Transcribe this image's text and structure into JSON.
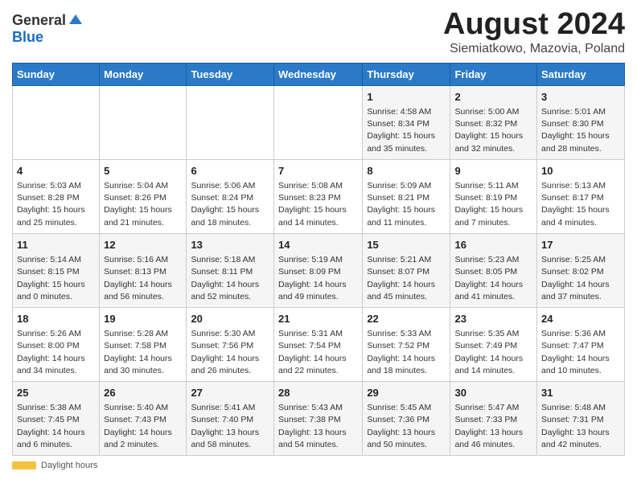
{
  "header": {
    "logo_general": "General",
    "logo_blue": "Blue",
    "month_title": "August 2024",
    "location": "Siemiatkowo, Mazovia, Poland"
  },
  "days_of_week": [
    "Sunday",
    "Monday",
    "Tuesday",
    "Wednesday",
    "Thursday",
    "Friday",
    "Saturday"
  ],
  "weeks": [
    [
      {
        "day": "",
        "info": ""
      },
      {
        "day": "",
        "info": ""
      },
      {
        "day": "",
        "info": ""
      },
      {
        "day": "",
        "info": ""
      },
      {
        "day": "1",
        "info": "Sunrise: 4:58 AM\nSunset: 8:34 PM\nDaylight: 15 hours\nand 35 minutes."
      },
      {
        "day": "2",
        "info": "Sunrise: 5:00 AM\nSunset: 8:32 PM\nDaylight: 15 hours\nand 32 minutes."
      },
      {
        "day": "3",
        "info": "Sunrise: 5:01 AM\nSunset: 8:30 PM\nDaylight: 15 hours\nand 28 minutes."
      }
    ],
    [
      {
        "day": "4",
        "info": "Sunrise: 5:03 AM\nSunset: 8:28 PM\nDaylight: 15 hours\nand 25 minutes."
      },
      {
        "day": "5",
        "info": "Sunrise: 5:04 AM\nSunset: 8:26 PM\nDaylight: 15 hours\nand 21 minutes."
      },
      {
        "day": "6",
        "info": "Sunrise: 5:06 AM\nSunset: 8:24 PM\nDaylight: 15 hours\nand 18 minutes."
      },
      {
        "day": "7",
        "info": "Sunrise: 5:08 AM\nSunset: 8:23 PM\nDaylight: 15 hours\nand 14 minutes."
      },
      {
        "day": "8",
        "info": "Sunrise: 5:09 AM\nSunset: 8:21 PM\nDaylight: 15 hours\nand 11 minutes."
      },
      {
        "day": "9",
        "info": "Sunrise: 5:11 AM\nSunset: 8:19 PM\nDaylight: 15 hours\nand 7 minutes."
      },
      {
        "day": "10",
        "info": "Sunrise: 5:13 AM\nSunset: 8:17 PM\nDaylight: 15 hours\nand 4 minutes."
      }
    ],
    [
      {
        "day": "11",
        "info": "Sunrise: 5:14 AM\nSunset: 8:15 PM\nDaylight: 15 hours\nand 0 minutes."
      },
      {
        "day": "12",
        "info": "Sunrise: 5:16 AM\nSunset: 8:13 PM\nDaylight: 14 hours\nand 56 minutes."
      },
      {
        "day": "13",
        "info": "Sunrise: 5:18 AM\nSunset: 8:11 PM\nDaylight: 14 hours\nand 52 minutes."
      },
      {
        "day": "14",
        "info": "Sunrise: 5:19 AM\nSunset: 8:09 PM\nDaylight: 14 hours\nand 49 minutes."
      },
      {
        "day": "15",
        "info": "Sunrise: 5:21 AM\nSunset: 8:07 PM\nDaylight: 14 hours\nand 45 minutes."
      },
      {
        "day": "16",
        "info": "Sunrise: 5:23 AM\nSunset: 8:05 PM\nDaylight: 14 hours\nand 41 minutes."
      },
      {
        "day": "17",
        "info": "Sunrise: 5:25 AM\nSunset: 8:02 PM\nDaylight: 14 hours\nand 37 minutes."
      }
    ],
    [
      {
        "day": "18",
        "info": "Sunrise: 5:26 AM\nSunset: 8:00 PM\nDaylight: 14 hours\nand 34 minutes."
      },
      {
        "day": "19",
        "info": "Sunrise: 5:28 AM\nSunset: 7:58 PM\nDaylight: 14 hours\nand 30 minutes."
      },
      {
        "day": "20",
        "info": "Sunrise: 5:30 AM\nSunset: 7:56 PM\nDaylight: 14 hours\nand 26 minutes."
      },
      {
        "day": "21",
        "info": "Sunrise: 5:31 AM\nSunset: 7:54 PM\nDaylight: 14 hours\nand 22 minutes."
      },
      {
        "day": "22",
        "info": "Sunrise: 5:33 AM\nSunset: 7:52 PM\nDaylight: 14 hours\nand 18 minutes."
      },
      {
        "day": "23",
        "info": "Sunrise: 5:35 AM\nSunset: 7:49 PM\nDaylight: 14 hours\nand 14 minutes."
      },
      {
        "day": "24",
        "info": "Sunrise: 5:36 AM\nSunset: 7:47 PM\nDaylight: 14 hours\nand 10 minutes."
      }
    ],
    [
      {
        "day": "25",
        "info": "Sunrise: 5:38 AM\nSunset: 7:45 PM\nDaylight: 14 hours\nand 6 minutes."
      },
      {
        "day": "26",
        "info": "Sunrise: 5:40 AM\nSunset: 7:43 PM\nDaylight: 14 hours\nand 2 minutes."
      },
      {
        "day": "27",
        "info": "Sunrise: 5:41 AM\nSunset: 7:40 PM\nDaylight: 13 hours\nand 58 minutes."
      },
      {
        "day": "28",
        "info": "Sunrise: 5:43 AM\nSunset: 7:38 PM\nDaylight: 13 hours\nand 54 minutes."
      },
      {
        "day": "29",
        "info": "Sunrise: 5:45 AM\nSunset: 7:36 PM\nDaylight: 13 hours\nand 50 minutes."
      },
      {
        "day": "30",
        "info": "Sunrise: 5:47 AM\nSunset: 7:33 PM\nDaylight: 13 hours\nand 46 minutes."
      },
      {
        "day": "31",
        "info": "Sunrise: 5:48 AM\nSunset: 7:31 PM\nDaylight: 13 hours\nand 42 minutes."
      }
    ]
  ],
  "footer": {
    "daylight_label": "Daylight hours"
  }
}
